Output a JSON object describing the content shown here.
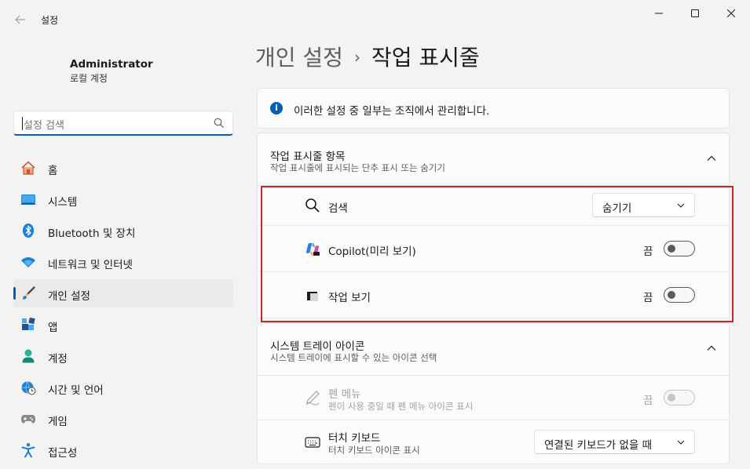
{
  "window": {
    "title": "설정",
    "controls": {
      "minimize": "minimize-icon",
      "maximize": "maximize-icon",
      "close": "close-icon"
    }
  },
  "user": {
    "name": "Administrator",
    "account_type": "로컬 계정"
  },
  "search": {
    "placeholder": "설정 검색"
  },
  "sidebar": {
    "items": [
      {
        "label": "홈",
        "icon": "home-icon",
        "active": false
      },
      {
        "label": "시스템",
        "icon": "system-icon",
        "active": false
      },
      {
        "label": "Bluetooth 및 장치",
        "icon": "bluetooth-icon",
        "active": false
      },
      {
        "label": "네트워크 및 인터넷",
        "icon": "wifi-icon",
        "active": false
      },
      {
        "label": "개인 설정",
        "icon": "paintbrush-icon",
        "active": true
      },
      {
        "label": "앱",
        "icon": "apps-icon",
        "active": false
      },
      {
        "label": "계정",
        "icon": "account-icon",
        "active": false
      },
      {
        "label": "시간 및 언어",
        "icon": "time-language-icon",
        "active": false
      },
      {
        "label": "게임",
        "icon": "gamepad-icon",
        "active": false
      },
      {
        "label": "접근성",
        "icon": "accessibility-icon",
        "active": false
      }
    ]
  },
  "breadcrumb": {
    "parent": "개인 설정",
    "separator": "›",
    "current": "작업 표시줄"
  },
  "info_banner": {
    "text": "이러한 설정 중 일부는 조직에서 관리합니다."
  },
  "taskbar_items": {
    "title": "작업 표시줄 항목",
    "subtitle": "작업 표시줄에 표시되는 단추 표시 또는 숨기기",
    "rows": [
      {
        "label": "검색",
        "icon": "search-icon",
        "control": "dropdown",
        "value": "숨기기"
      },
      {
        "label": "Copilot(미리 보기)",
        "icon": "copilot-icon",
        "control": "toggle",
        "state_label": "끔",
        "on": false
      },
      {
        "label": "작업 보기",
        "icon": "task-view-icon",
        "control": "toggle",
        "state_label": "끔",
        "on": false
      }
    ]
  },
  "tray_icons": {
    "title": "시스템 트레이 아이콘",
    "subtitle": "시스템 트레이에 표시할 수 있는 아이콘 선택",
    "rows": [
      {
        "label": "펜 메뉴",
        "sub": "펜이 사용 중일 때 펜 메뉴 아이콘 표시",
        "icon": "pen-icon",
        "control": "toggle",
        "state_label": "끔",
        "on": false,
        "disabled": true
      },
      {
        "label": "터치 키보드",
        "sub": "터치 키보드 아이콘 표시",
        "icon": "keyboard-icon",
        "control": "dropdown",
        "value": "연결된 키보드가 없을 때"
      }
    ]
  },
  "colors": {
    "accent": "#005fb8",
    "highlight_border": "#c62828"
  }
}
